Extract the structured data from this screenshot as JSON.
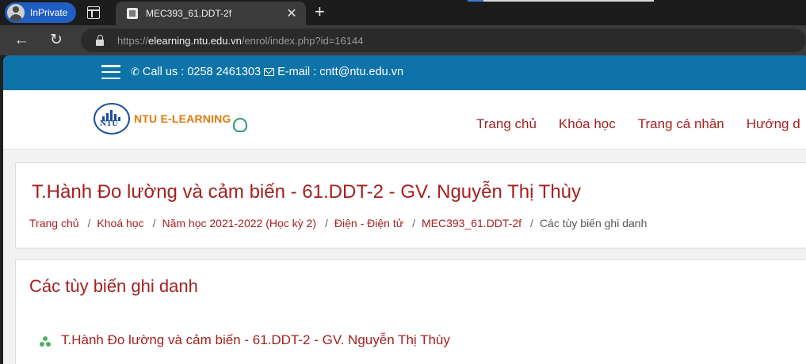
{
  "browser": {
    "inprivate_label": "InPrivate",
    "tab_title": "MEC393_61.DDT-2f",
    "tab_close": "✕",
    "new_tab": "+",
    "back": "←",
    "reload": "↻",
    "url_prefix": "https://",
    "url_host": "elearning.ntu.edu.vn",
    "url_path": "/enrol/index.php?id=16144"
  },
  "topbar": {
    "call_label": "Call us : 0258 2461303",
    "email_label": "E-mail : cntt@ntu.edu.vn"
  },
  "header": {
    "logo_badge": "NTU",
    "logo_text": "NTU E-LEARNING",
    "nav": [
      "Trang chủ",
      "Khóa học",
      "Trang cá nhân",
      "Hướng d"
    ]
  },
  "course": {
    "title": "T.Hành Đo lường và cảm biến - 61.DDT-2 - GV. Nguyễn Thị Thùy",
    "breadcrumb": [
      "Trang chủ",
      "Khoá học",
      "Năm học 2021-2022 (Học kỳ 2)",
      "Điện - Điện tử",
      "MEC393_61.DDT-2f"
    ],
    "breadcrumb_current": "Các tùy biến ghi danh",
    "breadcrumb_sep": "/"
  },
  "enrol": {
    "section_title": "Các tùy biến ghi danh",
    "course_link": "T.Hành Đo lường và cảm biến - 61.DDT-2 - GV. Nguyễn Thị Thùy"
  },
  "colors": {
    "topbar": "#0e73a8",
    "link": "#a52020",
    "inprivate": "#1f5fc4"
  }
}
